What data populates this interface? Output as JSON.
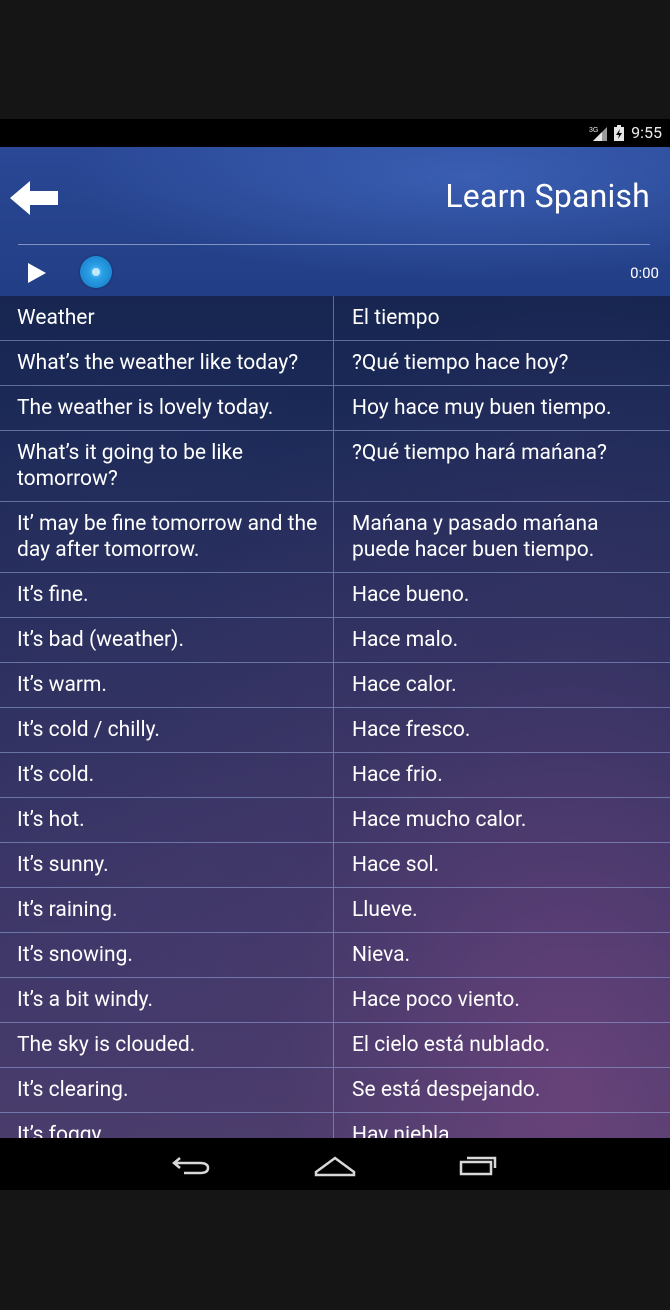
{
  "status_bar": {
    "network": "3G",
    "time": "9:55"
  },
  "header": {
    "title": "Learn Spanish",
    "back_icon": "back-arrow-icon",
    "play_icon": "play-icon"
  },
  "player": {
    "position_fraction": 0,
    "time": "0:00"
  },
  "phrases": [
    {
      "en": "Weather",
      "es": "El tiempo"
    },
    {
      "en": "What’s the weather like today?",
      "es": "?Qué tiempo hace hoy?"
    },
    {
      "en": "The weather is lovely today.",
      "es": "Hoy hace muy buen tiempo."
    },
    {
      "en": "What’s it going to be like tomorrow?",
      "es": "?Qué tiempo hará mańana?"
    },
    {
      "en": "It’ may be fine tomorrow and the day after tomorrow.",
      "es": "Mańana y pasado mańana puede hacer buen tiempo."
    },
    {
      "en": "It’s fine.",
      "es": "Hace bueno."
    },
    {
      "en": "It’s bad (weather).",
      "es": "Hace malo."
    },
    {
      "en": "It’s warm.",
      "es": "Hace calor."
    },
    {
      "en": "It’s cold / chilly.",
      "es": "Hace fresco."
    },
    {
      "en": "It’s cold.",
      "es": "Hace frio."
    },
    {
      "en": "It’s hot.",
      "es": "Hace mucho calor."
    },
    {
      "en": "It’s sunny.",
      "es": "Hace sol."
    },
    {
      "en": "It’s raining.",
      "es": "Llueve."
    },
    {
      "en": "It’s snowing.",
      "es": "Nieva."
    },
    {
      "en": "It’s a bit windy.",
      "es": "Hace poco viento."
    },
    {
      "en": "The sky is clouded.",
      "es": "El cielo está nublado."
    },
    {
      "en": "It’s clearing.",
      "es": "Se está despejando."
    },
    {
      "en": "It’s foggy.",
      "es": "Hay niebla."
    }
  ],
  "nav_bar": {
    "back_icon": "nav-back-icon",
    "home_icon": "nav-home-icon",
    "recents_icon": "nav-recents-icon"
  },
  "colors": {
    "header_blue": "#26438d",
    "seek_knob": "#1d88d2",
    "divider": "#96aadc"
  }
}
